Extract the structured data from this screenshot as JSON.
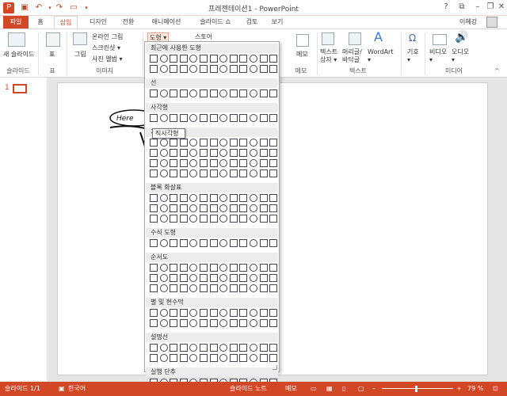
{
  "colors": {
    "accent": "#d24726",
    "statusbar": "#d24726",
    "ribbon_bg": "#ffffff",
    "canvas_bg": "#e5e5e5"
  },
  "qat": {
    "icons": [
      "powerpoint-logo-icon",
      "save-icon",
      "undo-icon",
      "redo-icon",
      "start-from-beginning-icon",
      "customize-qat-icon"
    ]
  },
  "window": {
    "title": "프레젠테이션1 - PowerPoint",
    "controls": [
      "?",
      "restore-ribbon",
      "minimize",
      "restore",
      "close"
    ]
  },
  "tabs": [
    {
      "label": "파일",
      "kind": "file"
    },
    {
      "label": "홈"
    },
    {
      "label": "삽입",
      "active": true
    },
    {
      "label": "디자인"
    },
    {
      "label": "전환"
    },
    {
      "label": "애니메이션"
    },
    {
      "label": "슬라이드 쇼"
    },
    {
      "label": "검토"
    },
    {
      "label": "보기"
    }
  ],
  "user": {
    "name": "이혜강"
  },
  "ribbon": {
    "new_slide": "새 슬라이드",
    "table": "표",
    "picture": "그림",
    "online_picture": "온라인 그림",
    "screenshot": "스크린샷 ▾",
    "photo_album": "사진 앨범 ▾",
    "shapes": "도형 ▾",
    "smartart": "스토어",
    "memo": "메모",
    "textbox": "텍스트\n상자 ▾",
    "header_footer": "머리글/\n바닥글",
    "wordart": "WordArt\n▾",
    "symbol": "기호\n▾",
    "video": "비디오\n▾",
    "audio": "오디오\n▾",
    "groups": {
      "slides": "슬라이드",
      "tables": "표",
      "images": "이미지",
      "comments": "메모",
      "text": "텍스트",
      "media": "미디어"
    }
  },
  "thumb": {
    "number": "1"
  },
  "slide_sketch": {
    "bubble_text": "Here"
  },
  "dropdown": {
    "sections": [
      {
        "title": "최근에 사용한 도형",
        "rows": 2
      },
      {
        "title": "선",
        "rows": 1
      },
      {
        "title": "사각형",
        "rows": 1
      },
      {
        "title": "기본 도형",
        "rows": 4
      },
      {
        "title": "블록 화살표",
        "rows": 3
      },
      {
        "title": "수식 도형",
        "rows": 1
      },
      {
        "title": "순서도",
        "rows": 3
      },
      {
        "title": "별 및 현수막",
        "rows": 2
      },
      {
        "title": "설명선",
        "rows": 2
      },
      {
        "title": "실행 단추",
        "rows": 1
      }
    ],
    "tooltip": "직사각형"
  },
  "status": {
    "slide": "슬라이드 1/1",
    "language": "한국어",
    "notes": "슬라이드 노트",
    "comments": "메모",
    "zoom": "79 %"
  }
}
